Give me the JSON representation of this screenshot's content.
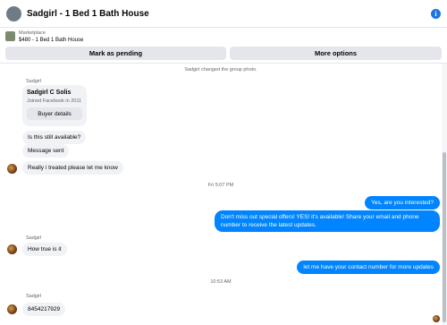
{
  "header": {
    "title": "Sadgirl - 1 Bed 1 Bath House"
  },
  "listing": {
    "source": "Marketplace",
    "price_title": "$480 - 1 Bed 1 Bath House"
  },
  "actions": {
    "pending": "Mark as pending",
    "more": "More options"
  },
  "system": {
    "group_photo": "Sadgirl changed the group photo."
  },
  "card": {
    "sender": "Sadgirl",
    "name": "Sadgirl C Solis",
    "joined": "Joined Facebook in 2011",
    "details": "Buyer details"
  },
  "messages": {
    "available": "Is this still available?",
    "sent": "Message sent",
    "treated": "Really i treated please let me know",
    "time1": "Fri 5:07 PM",
    "interested": "Yes, are you interested?",
    "offers": "Don't miss out special offers! YES! it's available! Share your email and phone number to receive the latest updates.",
    "sender2": "Sadgirl",
    "howtrue": "How true is it",
    "contact": "let me have your contact number for more updates",
    "time2": "10:53 AM",
    "sender3": "Sadgirl",
    "number": "8454217929"
  },
  "colors": {
    "accent": "#0084ff",
    "info": "#1b74e4",
    "bubble_in": "#f0f2f5"
  }
}
